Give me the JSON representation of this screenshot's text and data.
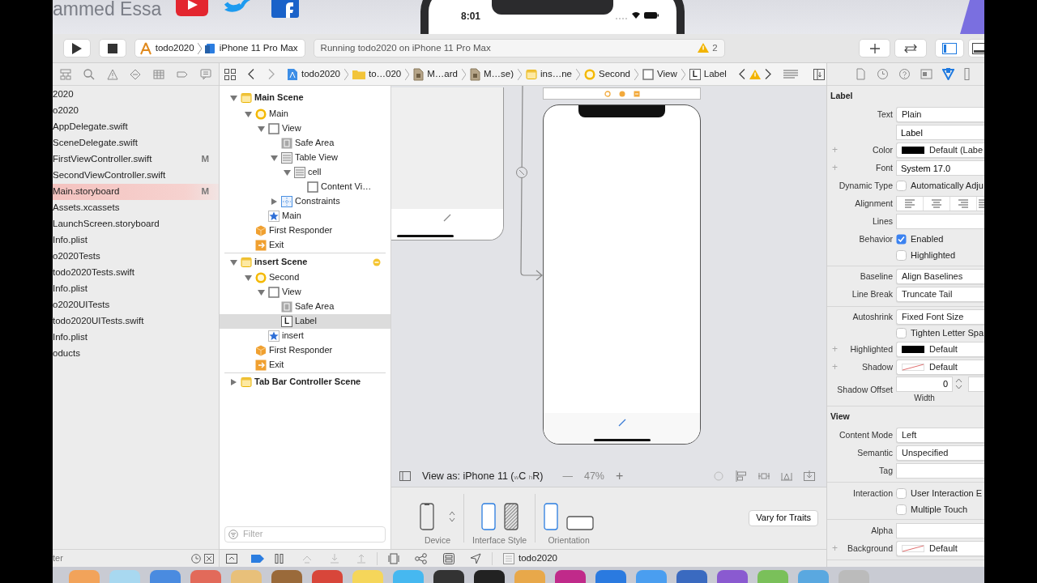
{
  "banner": {
    "channel_name": "ammed Essa",
    "phone_time": "8:01"
  },
  "toolbar": {
    "scheme": "todo2020",
    "destination": "iPhone 11 Pro Max",
    "activity": "Running todo2020 on iPhone 11 Pro Max",
    "warning_count": "2",
    "panels": [
      {
        "kind": "navigator",
        "selected": true
      },
      {
        "kind": "debug",
        "selected": false
      }
    ]
  },
  "navigator": {
    "files": [
      {
        "name": "2020",
        "selected": false
      },
      {
        "name": "o2020",
        "selected": false
      },
      {
        "name": "AppDelegate.swift",
        "selected": false
      },
      {
        "name": "SceneDelegate.swift",
        "selected": false
      },
      {
        "name": "FirstViewController.swift",
        "badge": "M",
        "selected": false
      },
      {
        "name": "SecondViewController.swift",
        "selected": false
      },
      {
        "name": "Main.storyboard",
        "badge": "M",
        "selected": true
      },
      {
        "name": "Assets.xcassets",
        "selected": false
      },
      {
        "name": "LaunchScreen.storyboard",
        "selected": false
      },
      {
        "name": "Info.plist",
        "selected": false
      },
      {
        "name": "o2020Tests",
        "selected": false
      },
      {
        "name": "todo2020Tests.swift",
        "selected": false
      },
      {
        "name": "Info.plist",
        "selected": false
      },
      {
        "name": "o2020UITests",
        "selected": false
      },
      {
        "name": "todo2020UITests.swift",
        "selected": false
      },
      {
        "name": "Info.plist",
        "selected": false
      },
      {
        "name": "oducts",
        "selected": false
      }
    ],
    "filter_placeholder": "ter"
  },
  "jump_bar": [
    {
      "kind": "project",
      "label": "todo2020"
    },
    {
      "kind": "folder",
      "label": "to…020"
    },
    {
      "kind": "storyboard",
      "label": "M…ard"
    },
    {
      "kind": "storyboard",
      "label": "M…se)"
    },
    {
      "kind": "scene",
      "label": "ins…ne"
    },
    {
      "kind": "controller",
      "label": "Second"
    },
    {
      "kind": "view",
      "label": "View"
    },
    {
      "kind": "label",
      "glyph": "L",
      "label": "Label"
    }
  ],
  "outline": {
    "scenes": [
      {
        "kind": "scene",
        "label": "Main Scene",
        "expanded": true,
        "warning": false,
        "selected": false,
        "children": [
          {
            "kind": "controller",
            "label": "Main",
            "expanded": true,
            "selected": false,
            "children": [
              {
                "kind": "view",
                "label": "View",
                "expanded": true,
                "selected": false,
                "children": [
                  {
                    "kind": "safearea",
                    "label": "Safe Area",
                    "selected": false
                  },
                  {
                    "kind": "table",
                    "label": "Table View",
                    "expanded": true,
                    "selected": false,
                    "children": [
                      {
                        "kind": "table",
                        "label": "cell",
                        "expanded": true,
                        "selected": false,
                        "children": [
                          {
                            "kind": "view",
                            "label": "Content Vi…",
                            "selected": false
                          }
                        ]
                      }
                    ]
                  },
                  {
                    "kind": "constraints",
                    "label": "Constraints",
                    "expanded": false,
                    "selected": false
                  }
                ]
              },
              {
                "kind": "item",
                "label": "Main",
                "selected": false
              }
            ]
          },
          {
            "kind": "responder",
            "label": "First Responder",
            "selected": false
          },
          {
            "kind": "exit",
            "label": "Exit",
            "selected": false
          }
        ]
      },
      {
        "kind": "scene",
        "label": "insert Scene",
        "expanded": true,
        "warning": true,
        "selected": false,
        "children": [
          {
            "kind": "controller",
            "label": "Second",
            "expanded": true,
            "selected": false,
            "children": [
              {
                "kind": "view",
                "label": "View",
                "expanded": true,
                "selected": false,
                "children": [
                  {
                    "kind": "safearea",
                    "label": "Safe Area",
                    "selected": false
                  },
                  {
                    "kind": "label",
                    "glyph": "L",
                    "label": "Label",
                    "selected": true
                  }
                ]
              },
              {
                "kind": "item",
                "label": "insert",
                "selected": false
              }
            ]
          },
          {
            "kind": "responder",
            "label": "First Responder",
            "selected": false
          },
          {
            "kind": "exit",
            "label": "Exit",
            "selected": false
          }
        ]
      },
      {
        "kind": "scene",
        "label": "Tab Bar Controller Scene",
        "expanded": false,
        "warning": false,
        "selected": false
      }
    ],
    "filter_placeholder": "Filter"
  },
  "canvas": {
    "view_as": "View as: iPhone 11 ($_{w}$C $_{h}$R)",
    "zoom_out": "—",
    "zoom": "47%",
    "zoom_in": "+",
    "device_label": "Device",
    "interface_style": {
      "label": "Interface Style",
      "options": [
        {
          "kind": "light",
          "selected": true
        },
        {
          "kind": "dark",
          "selected": false
        }
      ]
    },
    "orientation": {
      "label": "Orientation",
      "options": [
        {
          "kind": "portrait",
          "selected": true
        },
        {
          "kind": "landscape",
          "selected": false
        }
      ]
    },
    "vary_button": "Vary for Traits"
  },
  "debug_bar": {
    "breakpoints_on": true,
    "target": "todo2020"
  },
  "inspector": {
    "tabs": [
      {
        "kind": "file",
        "selected": false
      },
      {
        "kind": "history",
        "selected": false
      },
      {
        "kind": "help",
        "selected": false
      },
      {
        "kind": "identity",
        "selected": false
      },
      {
        "kind": "attributes",
        "selected": true
      },
      {
        "kind": "size",
        "selected": false
      }
    ],
    "sections": [
      {
        "title": "Label",
        "groups": [
          [
            {
              "kind": "select",
              "label": "Text",
              "value": "Plain"
            },
            {
              "kind": "field",
              "value": "Label"
            },
            {
              "kind": "color",
              "plus": "+",
              "label": "Color",
              "color": "#000000",
              "value": "Default (Labe"
            },
            {
              "kind": "field",
              "plus": "+",
              "label": "Font",
              "value": "System 17.0"
            },
            {
              "kind": "checkbox",
              "label": "Dynamic Type",
              "text": "Automatically Adju",
              "checked": false
            },
            {
              "kind": "alignment",
              "label": "Alignment"
            },
            {
              "kind": "field",
              "label": "Lines"
            },
            {
              "kind": "checkbox",
              "label": "Behavior",
              "text": "Enabled",
              "checked": true
            },
            {
              "kind": "checkbox",
              "text": "Highlighted",
              "checked": false
            }
          ],
          [
            {
              "kind": "select",
              "label": "Baseline",
              "value": "Align Baselines"
            },
            {
              "kind": "select",
              "label": "Line Break",
              "value": "Truncate Tail"
            }
          ],
          [
            {
              "kind": "select",
              "label": "Autoshrink",
              "value": "Fixed Font Size"
            },
            {
              "kind": "checkbox",
              "text": "Tighten Letter Spa",
              "checked": false
            },
            {
              "kind": "color",
              "plus": "+",
              "label": "Highlighted",
              "color": "#000000",
              "value": "Default"
            },
            {
              "kind": "clear",
              "plus": "+",
              "label": "Shadow",
              "value": "Default"
            },
            {
              "kind": "stepper",
              "label": "Shadow Offset",
              "value": "0",
              "caption": "Width"
            }
          ]
        ]
      },
      {
        "title": "View",
        "groups": [
          [
            {
              "kind": "select",
              "label": "Content Mode",
              "value": "Left"
            },
            {
              "kind": "select",
              "label": "Semantic",
              "value": "Unspecified"
            },
            {
              "kind": "field",
              "label": "Tag"
            }
          ],
          [
            {
              "kind": "checkbox",
              "label": "Interaction",
              "text": "User Interaction E",
              "checked": false
            },
            {
              "kind": "checkbox",
              "text": "Multiple Touch",
              "checked": false
            }
          ],
          [
            {
              "kind": "field",
              "label": "Alpha"
            },
            {
              "kind": "clear",
              "plus": "+",
              "label": "Background",
              "value": "Default"
            }
          ]
        ]
      }
    ]
  }
}
